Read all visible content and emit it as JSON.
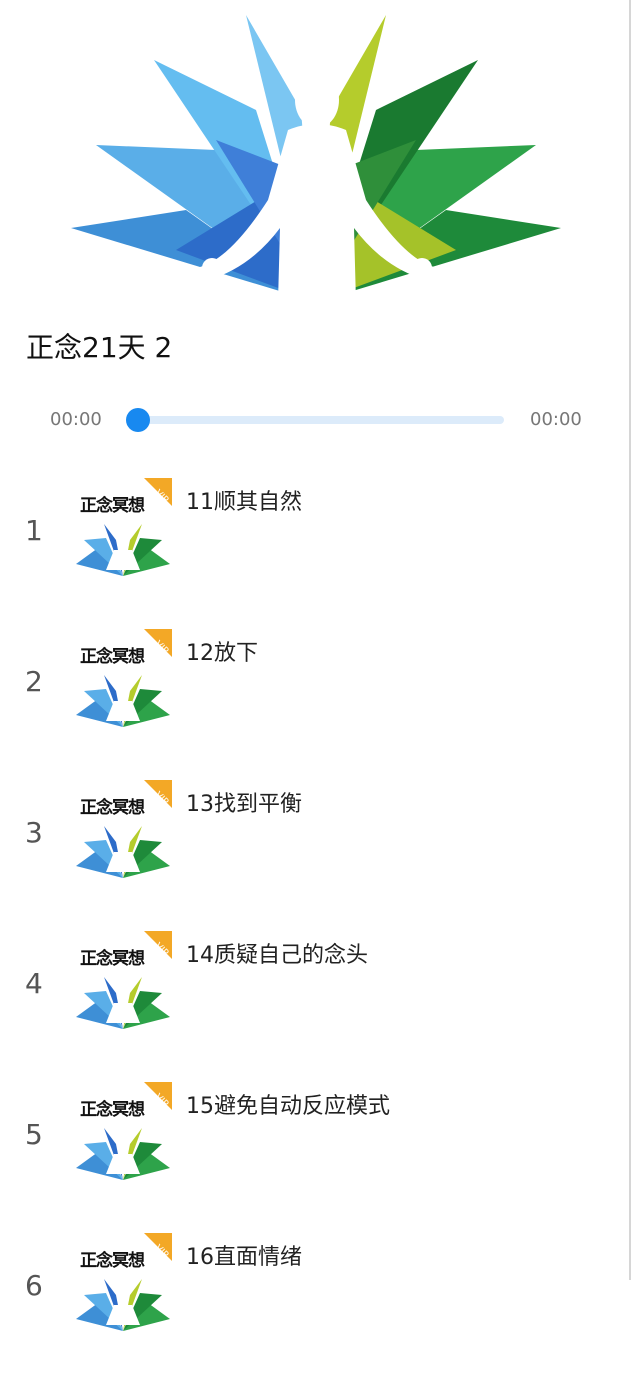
{
  "episode": {
    "title": "正念21天 2"
  },
  "player": {
    "current_time": "00:00",
    "total_time": "00:00",
    "progress": 0
  },
  "colors": {
    "accent": "#1889f0",
    "track": "#dcebfa"
  },
  "playlist": [
    {
      "index": "1",
      "badge": "正念冥想",
      "vip": "VIP",
      "title": "11顺其自然"
    },
    {
      "index": "2",
      "badge": "正念冥想",
      "vip": "VIP",
      "title": "12放下"
    },
    {
      "index": "3",
      "badge": "正念冥想",
      "vip": "VIP",
      "title": "13找到平衡"
    },
    {
      "index": "4",
      "badge": "正念冥想",
      "vip": "VIP",
      "title": "14质疑自己的念头"
    },
    {
      "index": "5",
      "badge": "正念冥想",
      "vip": "VIP",
      "title": "15避免自动反应模式"
    },
    {
      "index": "6",
      "badge": "正念冥想",
      "vip": "VIP",
      "title": "16直面情绪"
    }
  ]
}
